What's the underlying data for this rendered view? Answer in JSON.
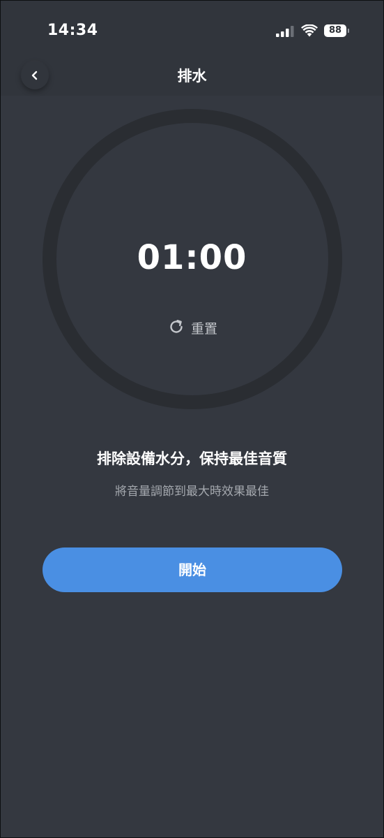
{
  "status_bar": {
    "time": "14:34",
    "battery_level": "88",
    "icons": [
      "signal-icon",
      "wifi-icon",
      "battery-icon"
    ]
  },
  "nav": {
    "title": "排水",
    "back_icon": "chevron-left-icon"
  },
  "timer": {
    "value": "01:00",
    "reset_label": "重置",
    "reset_icon": "refresh-icon"
  },
  "content": {
    "headline": "排除設備水分，保持最佳音質",
    "hint": "將音量調節到最大時效果最佳"
  },
  "actions": {
    "start_label": "開始"
  },
  "colors": {
    "background": "#343840",
    "ring": "#2a2d32",
    "accent": "#4a8fe3",
    "text_primary": "#ffffff",
    "text_secondary": "#a4a8ae"
  }
}
